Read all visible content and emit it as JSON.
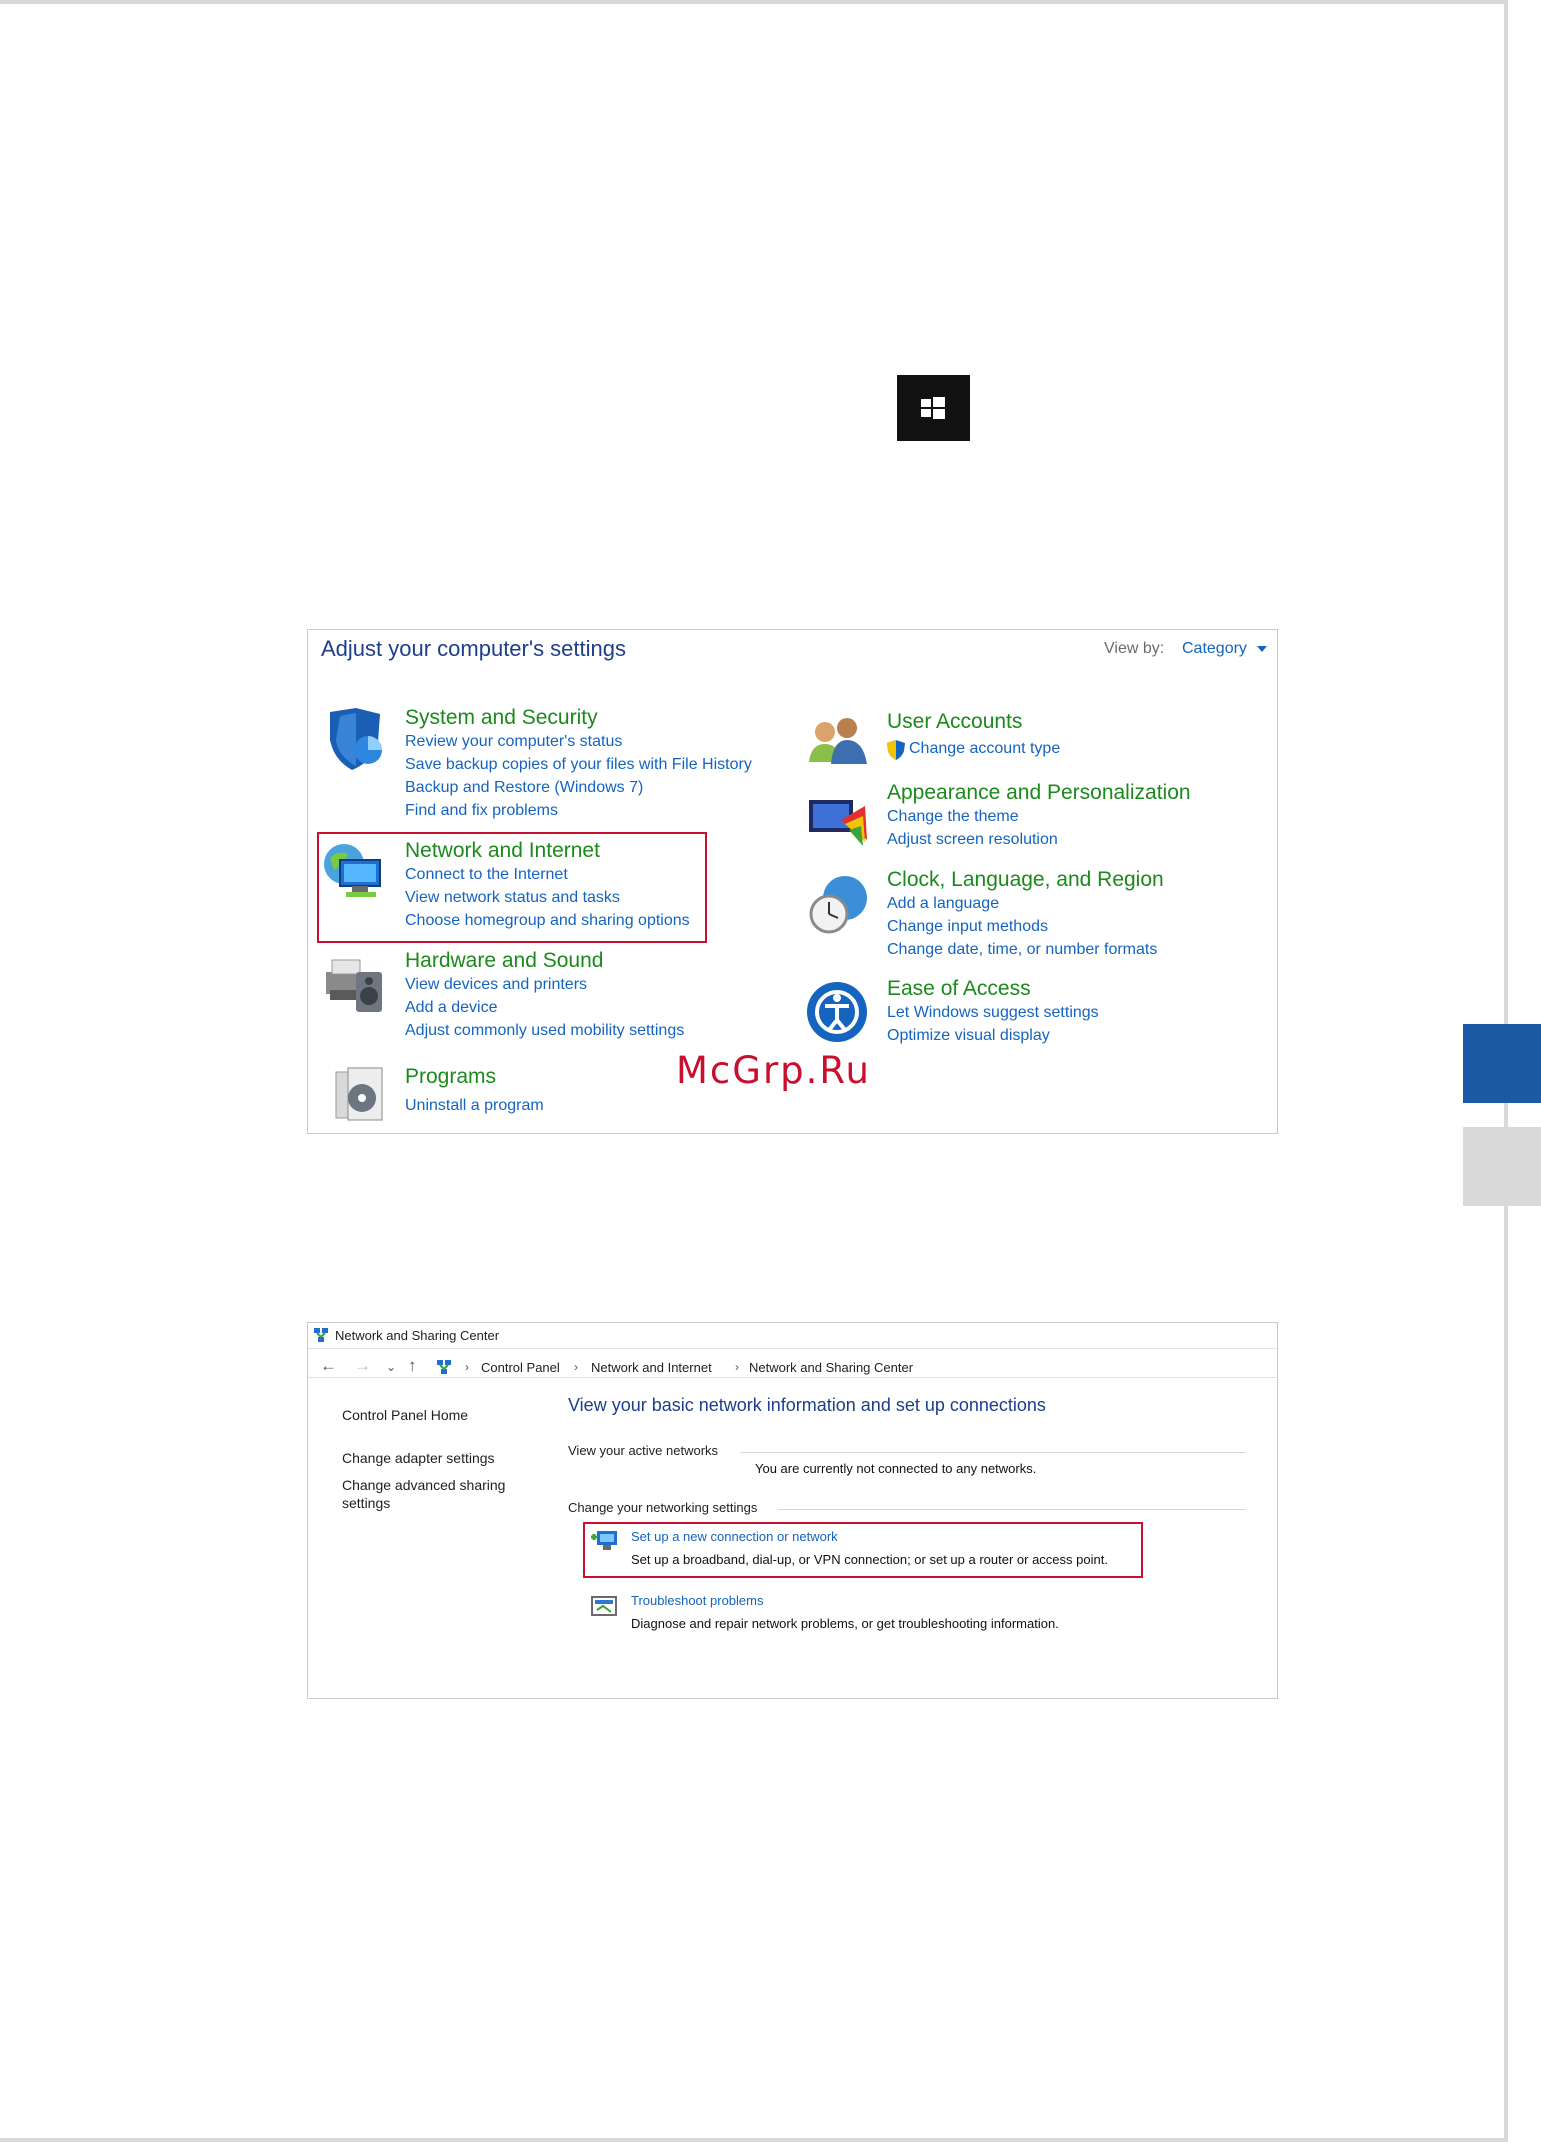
{
  "control_panel": {
    "title": "Adjust your computer's settings",
    "view_by_label": "View by:",
    "view_by_value": "Category",
    "left": [
      {
        "heading": "System and Security",
        "icon": "shield-icon",
        "links": [
          "Review your computer's status",
          "Save backup copies of your files with File History",
          "Backup and Restore (Windows 7)",
          "Find and fix problems"
        ]
      },
      {
        "heading": "Network and Internet",
        "icon": "network-globe-icon",
        "highlighted": true,
        "links": [
          "Connect to the Internet",
          "View network status and tasks",
          "Choose homegroup and sharing options"
        ]
      },
      {
        "heading": "Hardware and Sound",
        "icon": "printer-speaker-icon",
        "links": [
          "View devices and printers",
          "Add a device",
          "Adjust commonly used mobility settings"
        ]
      },
      {
        "heading": "Programs",
        "icon": "programs-disc-icon",
        "links": [
          "Uninstall a program"
        ]
      }
    ],
    "right": [
      {
        "heading": "User Accounts",
        "icon": "users-icon",
        "links": [
          "Change account type"
        ]
      },
      {
        "heading": "Appearance and Personalization",
        "icon": "monitor-palette-icon",
        "links": [
          "Change the theme",
          "Adjust screen resolution"
        ]
      },
      {
        "heading": "Clock, Language, and Region",
        "icon": "clock-globe-icon",
        "links": [
          "Add a language",
          "Change input methods",
          "Change date, time, or number formats"
        ]
      },
      {
        "heading": "Ease of Access",
        "icon": "ease-of-access-icon",
        "links": [
          "Let Windows suggest settings",
          "Optimize visual display"
        ]
      }
    ]
  },
  "watermark": "McGrp.Ru",
  "network_sharing": {
    "window_title": "Network and Sharing Center",
    "breadcrumbs": [
      "Control Panel",
      "Network and Internet",
      "Network and Sharing Center"
    ],
    "sidebar": [
      "Control Panel Home",
      "Change adapter settings",
      "Change advanced sharing",
      "settings"
    ],
    "heading": "View your basic network information and set up connections",
    "active_networks_label": "View your active networks",
    "not_connected": "You are currently not connected to any networks.",
    "change_settings_label": "Change your networking settings",
    "setup_link": "Set up a new connection or network",
    "setup_desc": "Set up a broadband, dial-up, or VPN connection; or set up a router or access point.",
    "troubleshoot_link": "Troubleshoot problems",
    "troubleshoot_desc": "Diagnose and repair network problems, or get troubleshooting information."
  }
}
